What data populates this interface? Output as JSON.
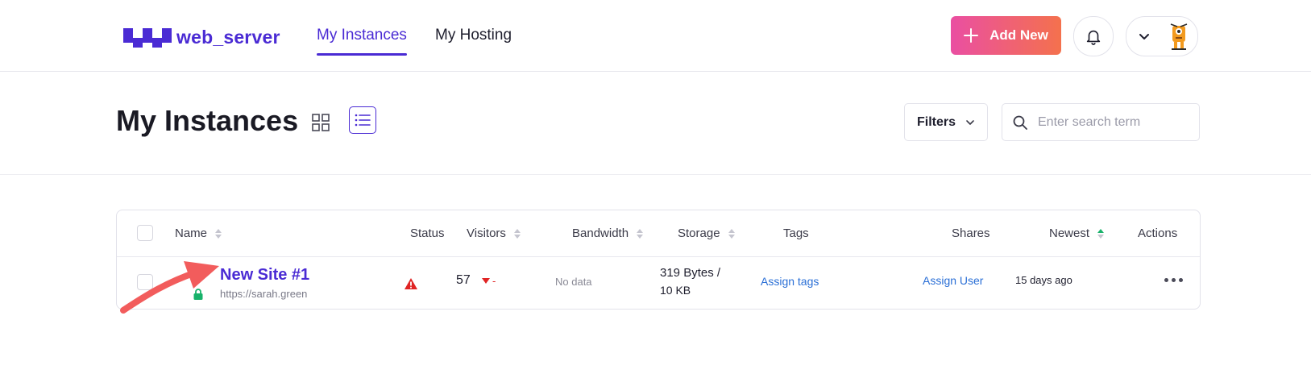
{
  "header": {
    "logo_text": "web_server",
    "nav_tabs": [
      {
        "label": "My Instances",
        "active": true
      },
      {
        "label": "My Hosting",
        "active": false
      }
    ],
    "add_new_label": "Add New"
  },
  "page": {
    "title": "My Instances",
    "filters_label": "Filters",
    "search_placeholder": "Enter search term"
  },
  "table": {
    "columns": {
      "name": "Name",
      "status": "Status",
      "visitors": "Visitors",
      "bandwidth": "Bandwidth",
      "storage": "Storage",
      "tags": "Tags",
      "shares": "Shares",
      "newest": "Newest",
      "actions": "Actions"
    },
    "rows": [
      {
        "name": "New Site #1",
        "url": "https://sarah.green",
        "visitors": "57",
        "visitors_change": "-",
        "bandwidth": "No data",
        "storage_line1": "319 Bytes /",
        "storage_line2": "10 KB",
        "tags_link": "Assign tags",
        "shares_link": "Assign User",
        "newest": "15 days ago"
      }
    ]
  },
  "colors": {
    "accent": "#4a2bd4",
    "add_gradient_start": "#ea4fa2",
    "add_gradient_end": "#f4714d",
    "status_warning": "#e02424",
    "ssl_lock": "#17b26a",
    "annotation_arrow": "#f25c5c"
  }
}
